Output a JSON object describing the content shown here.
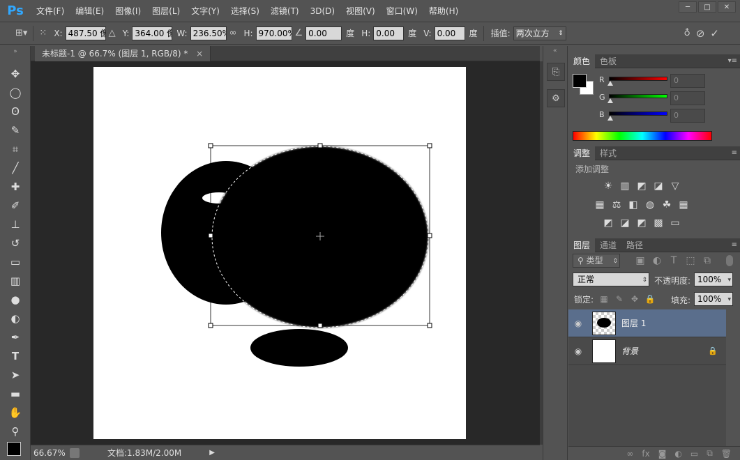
{
  "app": {
    "logo": "Ps"
  },
  "menu": [
    "文件(F)",
    "编辑(E)",
    "图像(I)",
    "图层(L)",
    "文字(Y)",
    "选择(S)",
    "滤镜(T)",
    "3D(D)",
    "视图(V)",
    "窗口(W)",
    "帮助(H)"
  ],
  "window_controls": {
    "minimize": "─",
    "maximize": "□",
    "close": "✕"
  },
  "options": {
    "x_label": "X:",
    "x_value": "487.50 像",
    "y_label": "Y:",
    "y_value": "364.00 像",
    "w_label": "W:",
    "w_value": "236.50%",
    "h_label": "H:",
    "h_value": "970.00%",
    "angle_value": "0.00",
    "angle_unit": "度",
    "hskew_label": "H:",
    "hskew_value": "0.00",
    "hskew_unit": "度",
    "vskew_label": "V:",
    "vskew_value": "0.00",
    "vskew_unit": "度",
    "interp_label": "插值:",
    "interp_value": "两次立方"
  },
  "document": {
    "tab_title": "未标题-1 @ 66.7% (图层 1, RGB/8) *",
    "tab_close": "×"
  },
  "status": {
    "zoom": "66.67%",
    "doc_info": "文档:1.83M/2.00M"
  },
  "color_panel": {
    "tabs": [
      "颜色",
      "色板"
    ],
    "channels": [
      {
        "label": "R",
        "value": "0"
      },
      {
        "label": "G",
        "value": "0"
      },
      {
        "label": "B",
        "value": "0"
      }
    ],
    "foreground": "#000000",
    "background": "#ffffff"
  },
  "adjust_panel": {
    "tabs": [
      "调整",
      "样式"
    ],
    "title": "添加调整"
  },
  "layers_panel": {
    "tabs": [
      "图层",
      "通道",
      "路径"
    ],
    "filter_label": "类型",
    "blend_mode": "正常",
    "opacity_label": "不透明度:",
    "opacity_value": "100%",
    "lock_label": "锁定:",
    "fill_label": "填充:",
    "fill_value": "100%",
    "layers": [
      {
        "name": "图层 1",
        "selected": true
      },
      {
        "name": "背景",
        "selected": false
      }
    ]
  }
}
